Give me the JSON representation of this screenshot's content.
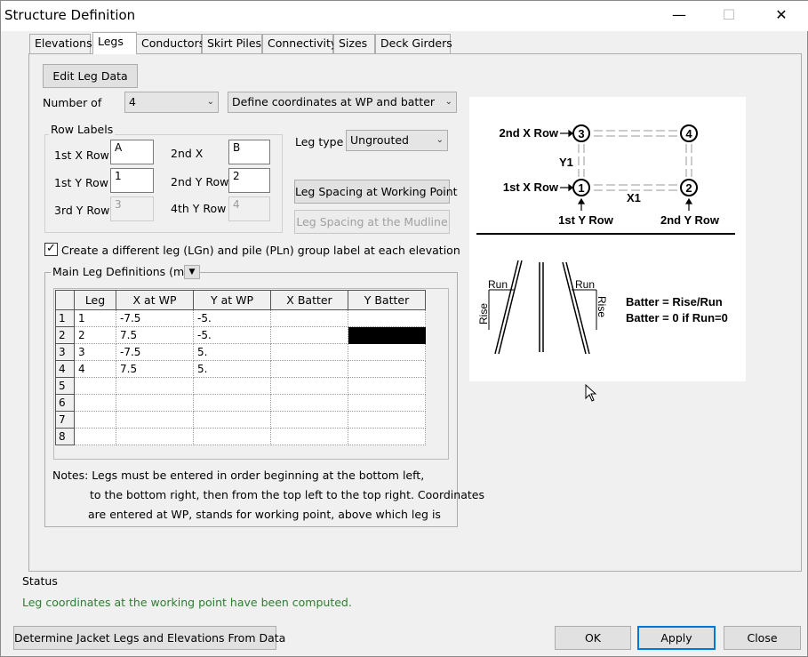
{
  "window": {
    "title": "Structure Definition",
    "minimize": "—",
    "maximize": "☐",
    "close": "✕"
  },
  "tabs": [
    {
      "label": "Elevations"
    },
    {
      "label": "Legs"
    },
    {
      "label": "Conductors"
    },
    {
      "label": "Skirt Piles"
    },
    {
      "label": "Connectivity"
    },
    {
      "label": "Sizes"
    },
    {
      "label": "Deck Girders"
    }
  ],
  "legs": {
    "edit_leg_data": "Edit Leg Data",
    "number_of_label": "Number of",
    "number_of_value": "4",
    "define_mode": "Define coordinates at WP and batter",
    "row_labels_title": "Row Labels",
    "x1_label": "1st X Row",
    "x1_value": "A",
    "x2_label": "2nd X",
    "x2_value": "B",
    "y1_label": "1st Y Row",
    "y1_value": "1",
    "y2_label": "2nd Y Row",
    "y2_value": "2",
    "y3_label": "3rd Y Row",
    "y3_value": "3",
    "y4_label": "4th Y Row",
    "y4_value": "4",
    "leg_type_label": "Leg type",
    "leg_type_value": "Ungrouted",
    "spacing_wp": "Leg Spacing at Working Point",
    "spacing_mud": "Leg Spacing at the Mudline",
    "create_label_checkbox": "Create a different leg (LGn) and pile (PLn) group label at each elevation",
    "create_label_checked": true,
    "main_defs_title": "Main Leg Definitions (m)",
    "columns": [
      "Leg",
      "X at WP",
      "Y at WP",
      "X Batter",
      "Y Batter"
    ],
    "rows": [
      {
        "n": "1",
        "leg": "1",
        "x": "-7.5",
        "y": "-5.",
        "xb": "",
        "yb": ""
      },
      {
        "n": "2",
        "leg": "2",
        "x": "7.5",
        "y": "-5.",
        "xb": "",
        "yb": ""
      },
      {
        "n": "3",
        "leg": "3",
        "x": "-7.5",
        "y": "5.",
        "xb": "",
        "yb": ""
      },
      {
        "n": "4",
        "leg": "4",
        "x": "7.5",
        "y": "5.",
        "xb": "",
        "yb": ""
      },
      {
        "n": "5",
        "leg": "",
        "x": "",
        "y": "",
        "xb": "",
        "yb": ""
      },
      {
        "n": "6",
        "leg": "",
        "x": "",
        "y": "",
        "xb": "",
        "yb": ""
      },
      {
        "n": "7",
        "leg": "",
        "x": "",
        "y": "",
        "xb": "",
        "yb": ""
      },
      {
        "n": "8",
        "leg": "",
        "x": "",
        "y": "",
        "xb": "",
        "yb": ""
      }
    ],
    "notes_1": "Notes:  Legs must be entered in order beginning at the bottom left,",
    "notes_2": "to the bottom right, then from the top left to the top right.  Coordinates",
    "notes_3": "are entered at WP, stands for working point, above which leg is"
  },
  "diagram": {
    "x2_row": "2nd X Row",
    "x1_row": "1st X Row",
    "y1_row": "1st Y Row",
    "y2_row": "2nd Y Row",
    "y1": "Y1",
    "x1": "X1",
    "n1": "1",
    "n2": "2",
    "n3": "3",
    "n4": "4",
    "run": "Run",
    "rise": "Rise",
    "batter_1": "Batter = Rise/Run",
    "batter_2": "Batter = 0 if Run=0"
  },
  "status": {
    "title": "Status",
    "message": "Leg coordinates at the working point have been computed.",
    "color": "#2e7d32"
  },
  "footer": {
    "determine": "Determine Jacket Legs and Elevations From Data",
    "ok": "OK",
    "apply": "Apply",
    "close": "Close"
  }
}
